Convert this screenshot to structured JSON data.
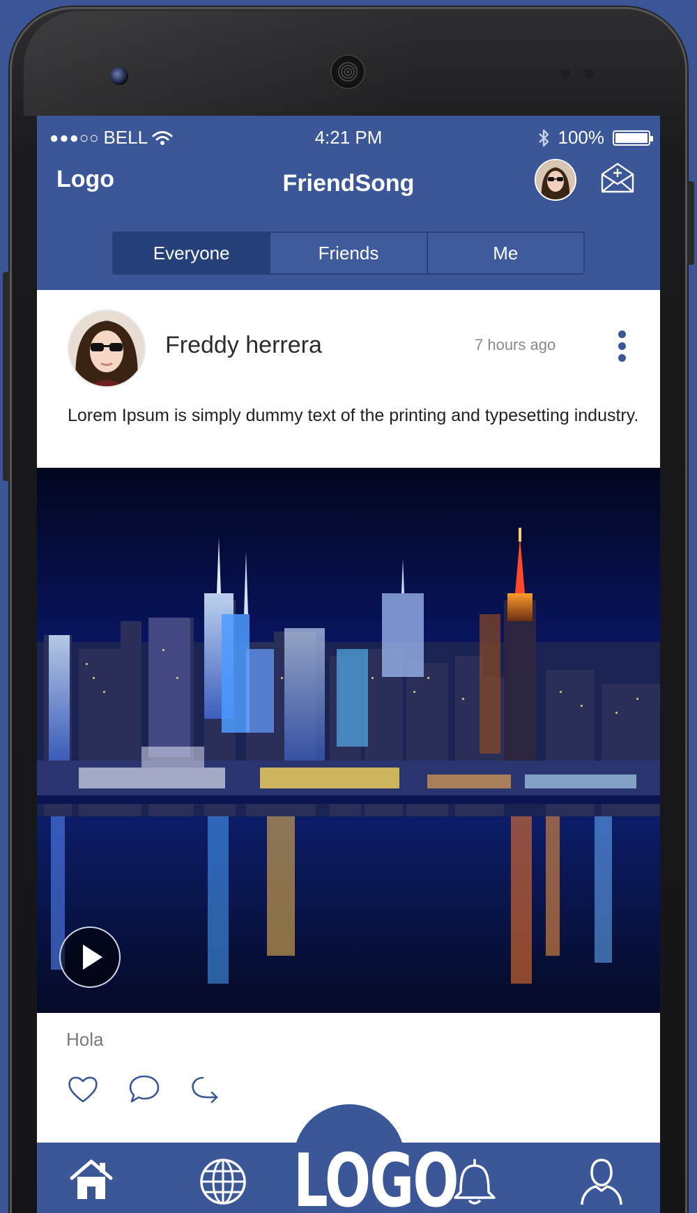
{
  "status_bar": {
    "signal": "●●●○○",
    "carrier": "BELL",
    "time": "4:21 PM",
    "battery": "100%"
  },
  "header": {
    "logo": "Logo",
    "title": "FriendSong"
  },
  "tabs": [
    {
      "label": "Everyone",
      "active": true
    },
    {
      "label": "Friends",
      "active": false
    },
    {
      "label": "Me",
      "active": false
    }
  ],
  "post": {
    "author": "Freddy herrera",
    "time": "7 hours ago",
    "text": "Lorem Ipsum is simply dummy text of the printing and typesetting industry.",
    "caption": "Hola"
  },
  "bottom_nav": {
    "center_logo": "LOGO",
    "items": [
      "home-icon",
      "globe-icon",
      "bell-icon",
      "profile-icon"
    ]
  },
  "colors": {
    "brand": "#3b5797",
    "tab_active": "#253f78",
    "background": "#3b5596"
  }
}
